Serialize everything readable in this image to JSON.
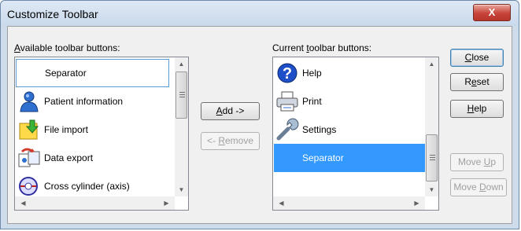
{
  "window": {
    "title": "Customize Toolbar",
    "close_glyph": "X"
  },
  "available": {
    "label_prefix": "",
    "label_accel": "A",
    "label_rest": "vailable toolbar buttons:",
    "items": [
      {
        "label": "Separator",
        "icon": "separator"
      },
      {
        "label": "Patient information",
        "icon": "patient-icon"
      },
      {
        "label": "File import",
        "icon": "file-import-icon"
      },
      {
        "label": "Data export",
        "icon": "data-export-icon"
      },
      {
        "label": "Cross cylinder (axis)",
        "icon": "cross-cylinder-icon"
      }
    ]
  },
  "current": {
    "label_prefix": "Current ",
    "label_accel": "t",
    "label_rest": "oolbar buttons:",
    "items": [
      {
        "label": "Help",
        "icon": "help-icon"
      },
      {
        "label": "Print",
        "icon": "printer-icon"
      },
      {
        "label": "Settings",
        "icon": "wrench-icon"
      },
      {
        "label": "Separator",
        "icon": "separator"
      }
    ]
  },
  "buttons": {
    "add": {
      "accel": "A",
      "rest": "dd ->"
    },
    "remove": {
      "prefix": "<- ",
      "accel": "R",
      "rest": "emove"
    },
    "close": {
      "accel": "C",
      "rest": "lose"
    },
    "reset": {
      "prefix": "R",
      "accel": "e",
      "rest": "set"
    },
    "help": {
      "accel": "H",
      "rest": "elp"
    },
    "move_up": {
      "prefix": "Move ",
      "accel": "U",
      "rest": "p"
    },
    "move_down": {
      "prefix": "Move ",
      "accel": "D",
      "rest": "own"
    }
  }
}
